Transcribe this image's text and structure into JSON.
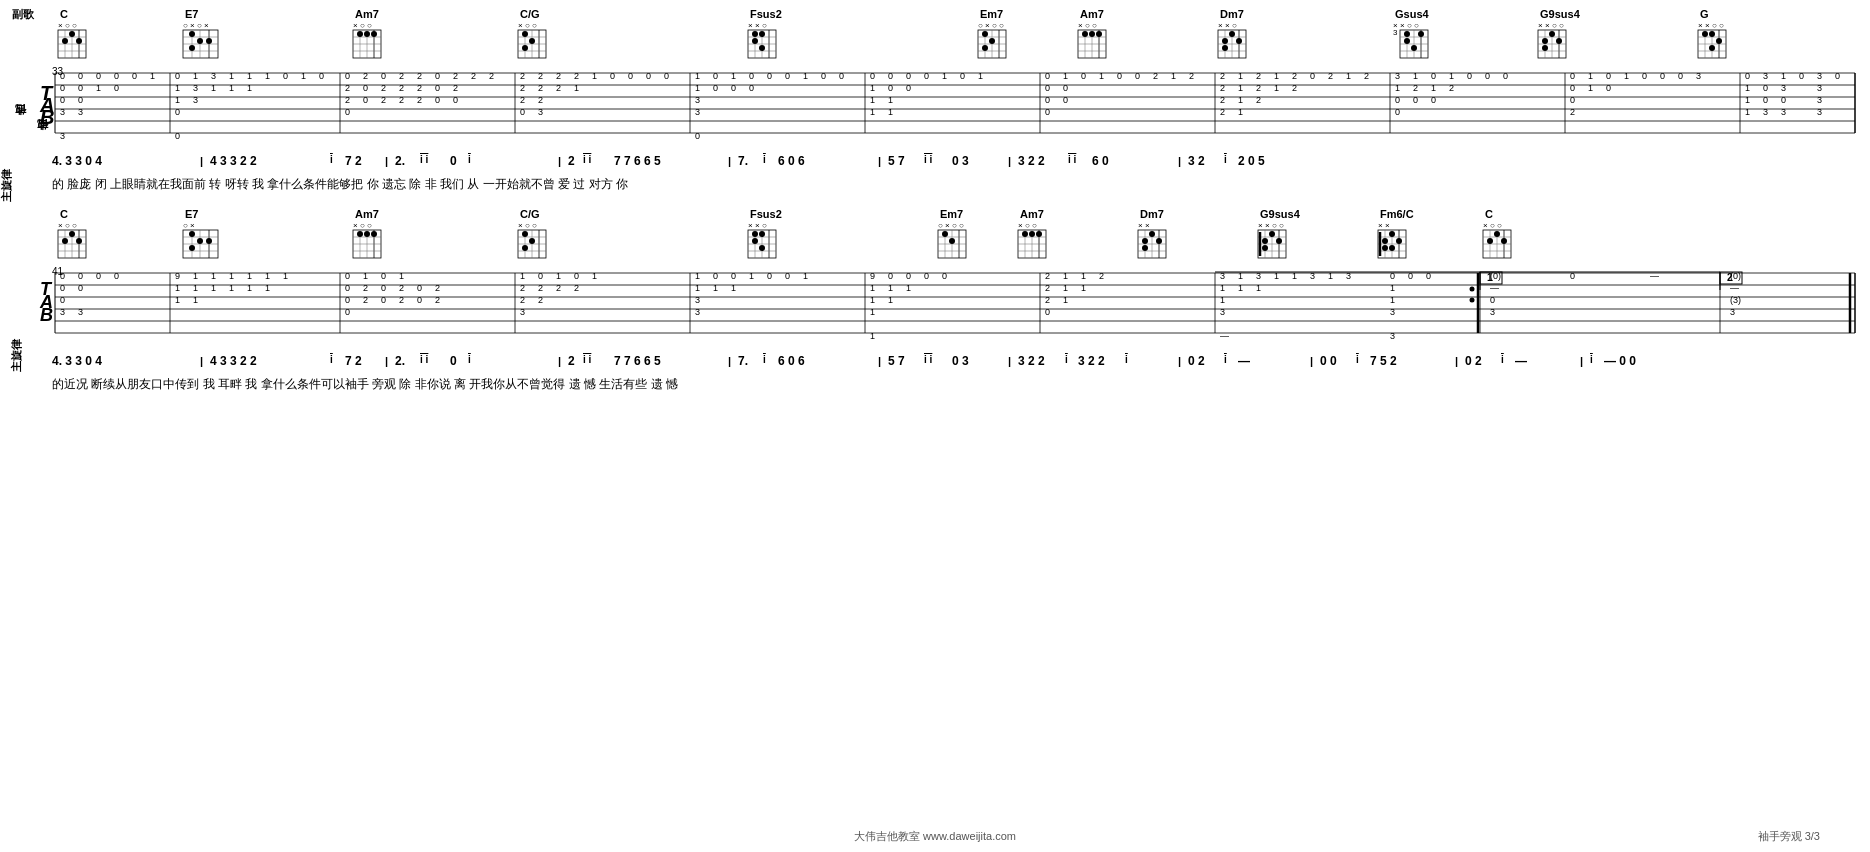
{
  "page": {
    "title": "袖手旁观",
    "page_number": "3/3",
    "footer_text": "大伟吉他教室 www.daweijita.com",
    "footer_title": "袖手旁观"
  },
  "section1": {
    "label": "副歌",
    "guitar_label": "吉他",
    "notation_label": "主旋律"
  },
  "chords_row1": [
    {
      "name": "C",
      "markers": "x o o",
      "fret": ""
    },
    {
      "name": "E7",
      "markers": "o x o x o o",
      "fret": ""
    },
    {
      "name": "Am7",
      "markers": "x o o",
      "fret": ""
    },
    {
      "name": "C/G",
      "markers": "x o o",
      "fret": ""
    },
    {
      "name": "Fsus2",
      "markers": "x x o",
      "fret": ""
    },
    {
      "name": "Em7",
      "markers": "o x o o",
      "fret": ""
    },
    {
      "name": "Am7",
      "markers": "x o o",
      "fret": ""
    },
    {
      "name": "Dm7",
      "markers": "x x o",
      "fret": ""
    },
    {
      "name": "Gsus4",
      "markers": "x x o o",
      "fret": "3"
    },
    {
      "name": "G9sus4",
      "markers": "x x o o",
      "fret": ""
    },
    {
      "name": "G",
      "markers": "x x o o",
      "fret": ""
    }
  ],
  "tab_row1": {
    "measure_start": "33",
    "strings": [
      "0--0--0--0-1-3-1--1-1-1---0-1---2-0-2-2-2-0-2--2-2-2--2-2--1--0-0-0-0-0-1-0-1-0-0-2-1-2--2-1-2--1-2--1-0-0-0-0-3-0-1-0-1-0-0-0-3-0",
      "0--0--0-0--1-3-1--1-1-1-0-0----2-0-2-2-2-0-2--2-2-2--2-2--1--0-0-0-0-0---0-0-0-0-0-2-1-2--2-1-2--1-2--1-0-0-0-0-3-0-1-0-1-0-0-0-3-0",
      "0--0--------1-3--0-1----0-0-0-0-2-0-2-2-2-0-2--0-----2-2--0--0-0-0-0-0--0-0-0-0-0-2-1-2--2-1-2--1-2-0-0-0---0-3-0-1-0-1-0-0-0-0",
      "3--3--3-3----------3--3-3-0----0-0-0-0-----3--3-3--3--3--1--1-0-0-0-0-0----------0-2-1-2--2-1-2--1-2--3-3-3-3--0-1-0-1-0-0-0-3-3"
    ]
  },
  "notation_row1": "4. 3 3 0 4 | 4 3 3 2 2 i 7 2 | 2. i i 0 i | 2 i i 7 7 6 6 5 | 7. i 6 0 6 | 5 7 i i 0 3 | 3 2 2 i i 6 0 | 3 2 i 2 0 5",
  "lyrics_row1": "的 脸庞 闭 上眼睛就在我面前 转 呀转 我 拿什么条件能够把 你 遗忘 除 非 我们 从 一开始就不曾 爱 过 对方 你",
  "chords_row2": [
    {
      "name": "C",
      "markers": "x o o",
      "fret": ""
    },
    {
      "name": "E7",
      "markers": "o x o x o o",
      "fret": ""
    },
    {
      "name": "Am7",
      "markers": "x o o",
      "fret": ""
    },
    {
      "name": "C/G",
      "markers": "x o o",
      "fret": ""
    },
    {
      "name": "Fsus2",
      "markers": "x x o",
      "fret": ""
    },
    {
      "name": "Em7",
      "markers": "o x o o",
      "fret": ""
    },
    {
      "name": "Am7",
      "markers": "x o o",
      "fret": ""
    },
    {
      "name": "Dm7",
      "markers": "x x",
      "fret": ""
    },
    {
      "name": "G9sus4",
      "markers": "x x o o",
      "fret": ""
    },
    {
      "name": "Fm6/C",
      "markers": "x x",
      "fret": ""
    }
  ],
  "tab_row2": {
    "measure_start": "41",
    "ending_brackets": [
      "1",
      "2"
    ]
  },
  "notation_row2": "4. 3 3 0 4 | 4 3 3 2 2 i 7 2 | 2. i i 0 i | 2 i i 7 7 6 6 5 | 7. i 6 0 6 | 5 7 i i 0 3 | 3 2 2 i 3 2 2 i | 0 2 i — | 0 0 i 7 5 2 | 0 2 i — | i — 0 0",
  "lyrics_row2": "的近况 断续从朋友口中传到 我 耳畔 我 拿什么条件可以袖手 旁观 除 非你说 离 开我你从不曾觉得 遗 憾 生活有些 遗 憾"
}
